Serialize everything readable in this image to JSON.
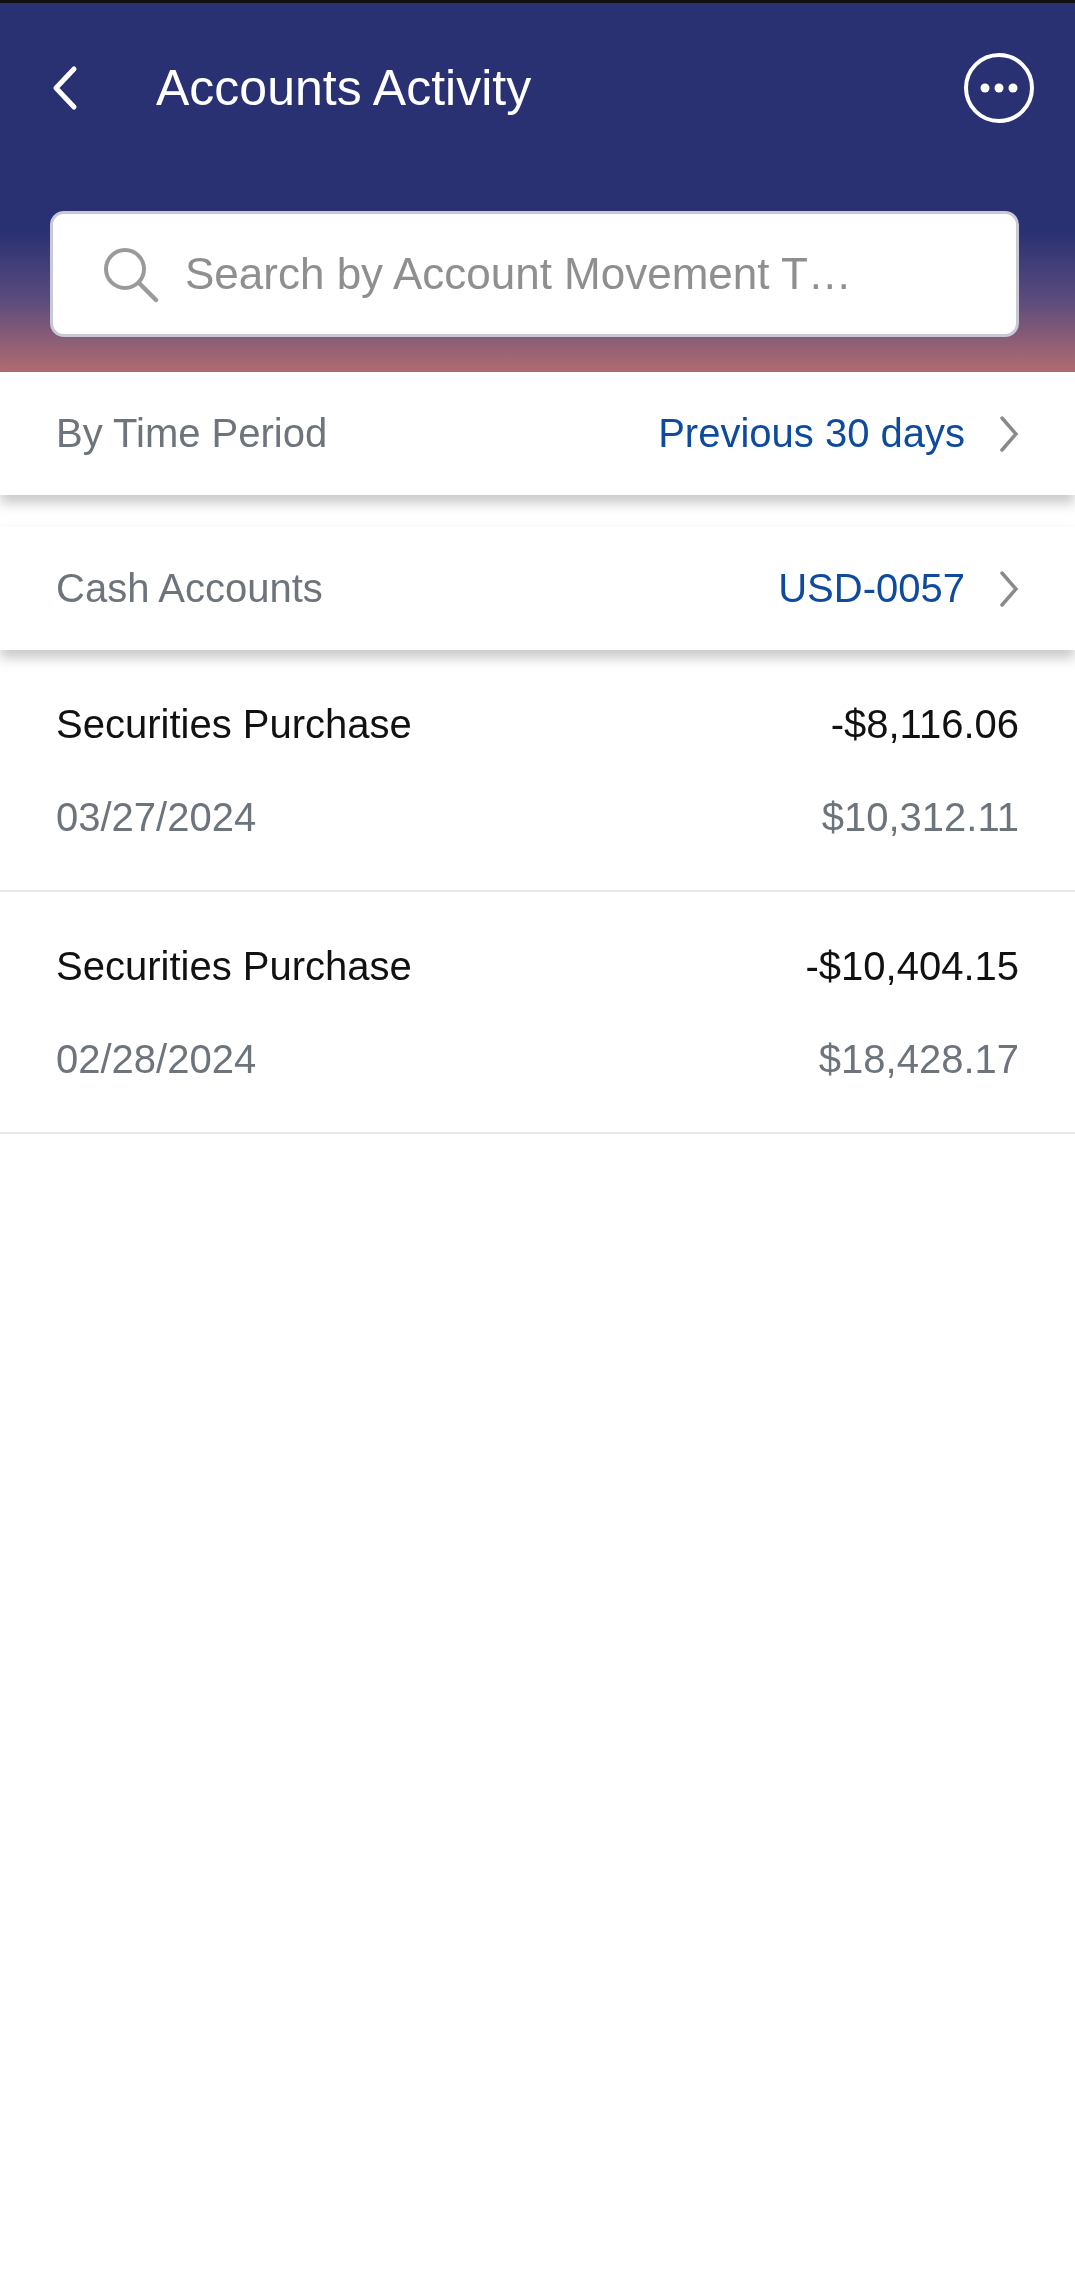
{
  "header": {
    "title": "Accounts Activity"
  },
  "search": {
    "placeholder": "Search by Account Movement T…"
  },
  "filters": [
    {
      "label": "By Time Period",
      "value": "Previous 30 days"
    },
    {
      "label": "Cash Accounts",
      "value": "USD-0057"
    }
  ],
  "transactions": [
    {
      "description": "Securities Purchase",
      "amount": "-$8,116.06",
      "date": "03/27/2024",
      "balance": "$10,312.11"
    },
    {
      "description": "Securities Purchase",
      "amount": "-$10,404.15",
      "date": "02/28/2024",
      "balance": "$18,428.17"
    }
  ]
}
